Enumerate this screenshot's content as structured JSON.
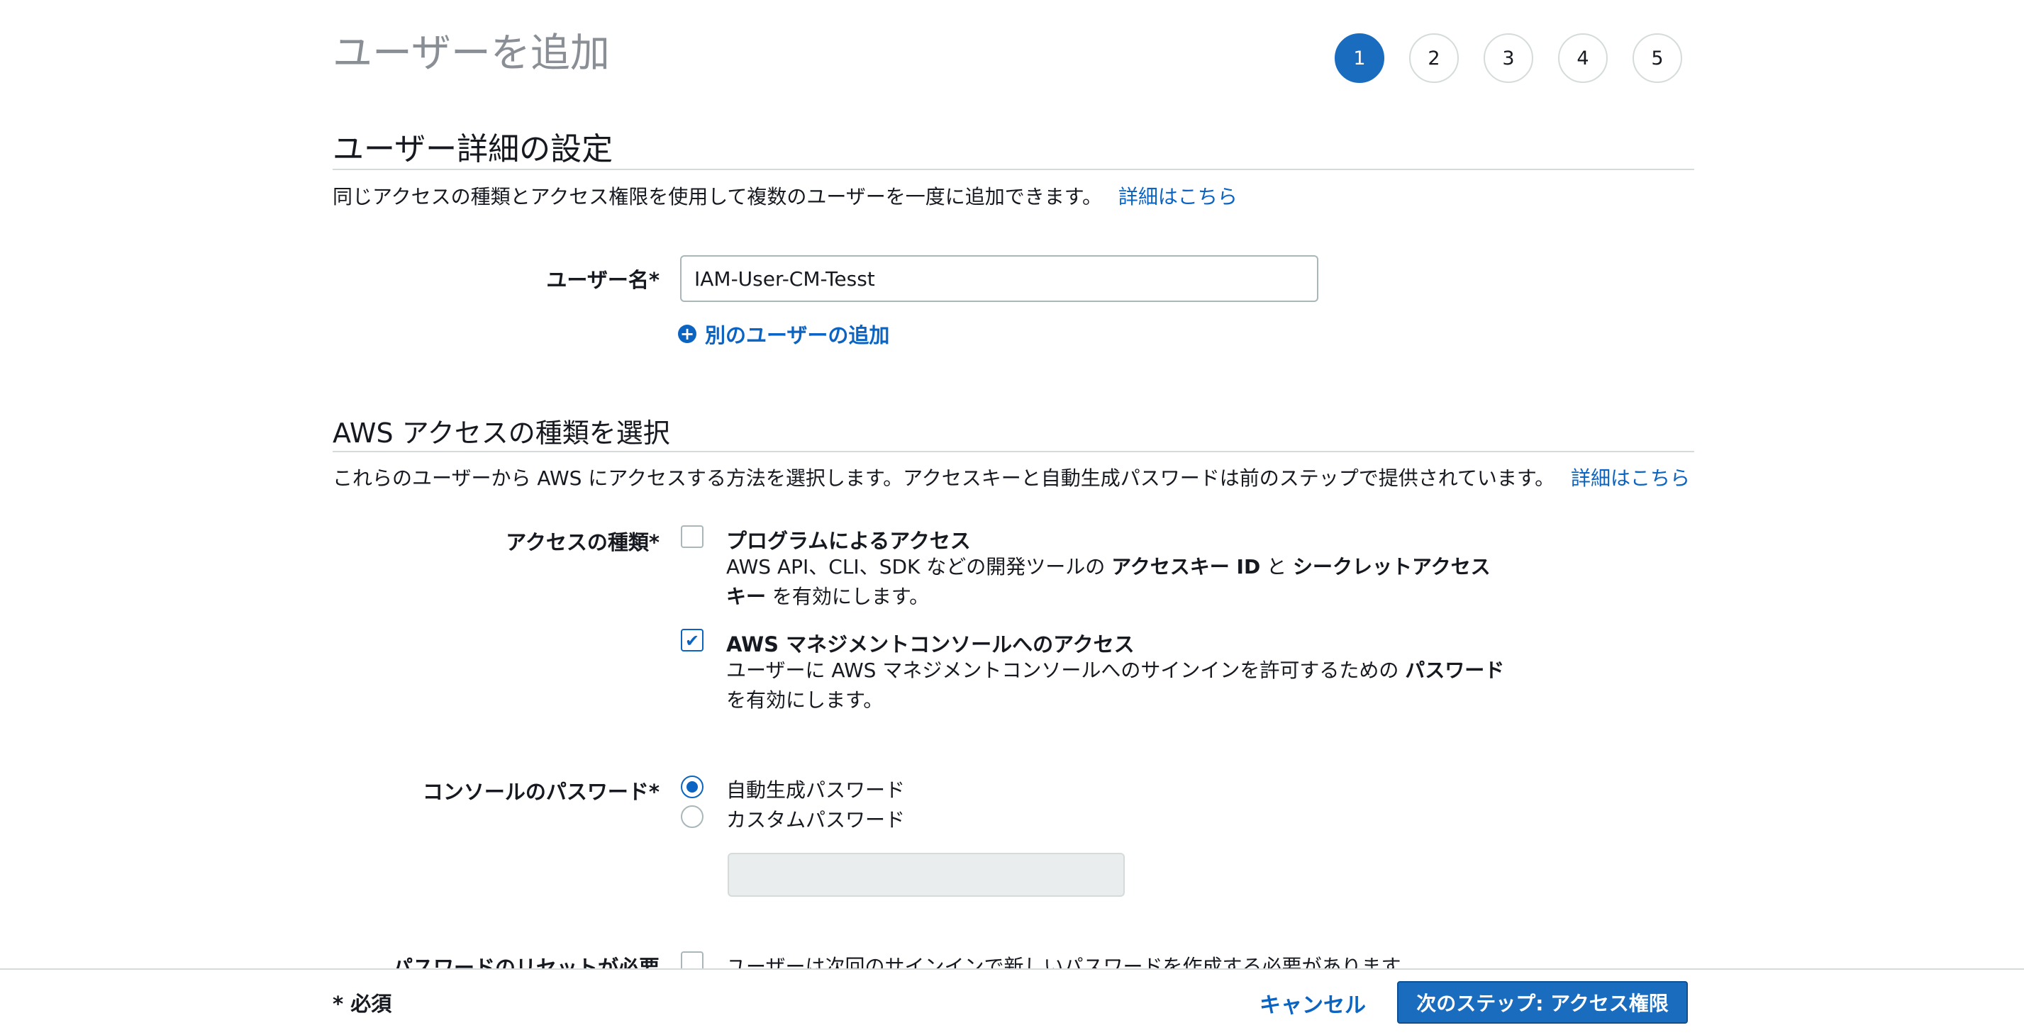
{
  "page_title": "ユーザーを追加",
  "steps": [
    "1",
    "2",
    "3",
    "4",
    "5"
  ],
  "active_step": "1",
  "details_section": {
    "title": "ユーザー詳細の設定",
    "description": "同じアクセスの種類とアクセス権限を使用して複数のユーザーを一度に追加できます。",
    "learn_more": "詳細はこちら",
    "username_label": "ユーザー名*",
    "username_value": "IAM-User-CM-Tesst",
    "add_user_link": "別のユーザーの追加"
  },
  "access_section": {
    "title": "AWS アクセスの種類を選択",
    "description": "これらのユーザーから AWS にアクセスする方法を選択します。アクセスキーと自動生成パスワードは前のステップで提供されています。",
    "learn_more": "詳細はこちら",
    "access_type_label": "アクセスの種類*",
    "programmatic": {
      "title": "プログラムによるアクセス",
      "desc_1": "AWS API、CLI、SDK などの開発ツールの ",
      "desc_bold_1": "アクセスキー ID",
      "desc_2": " と ",
      "desc_bold_2": "シークレットアクセス",
      "desc_bold_3": "キー",
      "desc_3": " を有効にします。",
      "checked": false
    },
    "console": {
      "title": "AWS マネジメントコンソールへのアクセス",
      "desc_1": "ユーザーに AWS マネジメントコンソールへのサインインを許可するための ",
      "desc_bold_1": "パスワード",
      "desc_2": "を有効にします。",
      "checked": true
    },
    "console_password_label": "コンソールのパスワード*",
    "password_options": [
      "自動生成パスワード",
      "カスタムパスワード"
    ],
    "selected_password_option": "自動生成パスワード",
    "reset_label": "パスワードのリセットが必要",
    "reset_text": "ユーザーは次回のサインインで新しいパスワードを作成する必要があります"
  },
  "footer": {
    "required_note": "* 必須",
    "cancel": "キャンセル",
    "next": "次のステップ: アクセス権限"
  },
  "colors": {
    "accent": "#1a6cbf",
    "link": "#0b64c1"
  }
}
